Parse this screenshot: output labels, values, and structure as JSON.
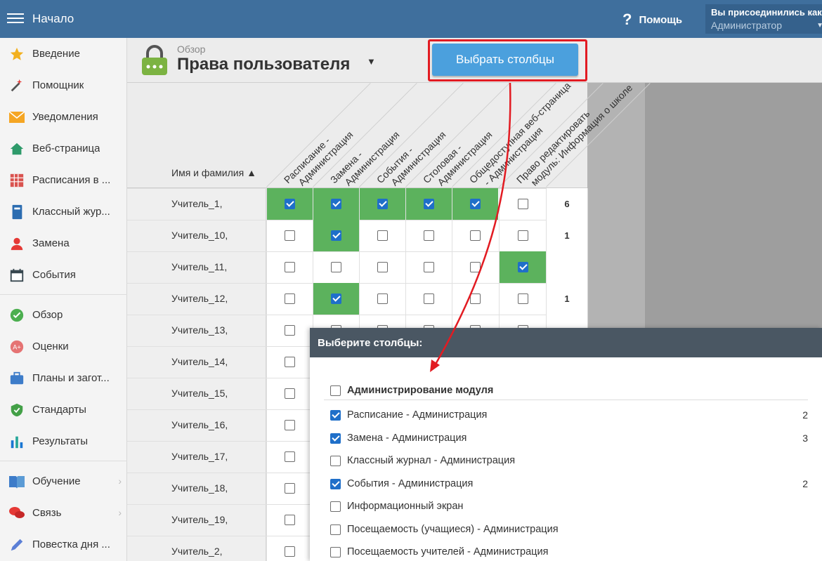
{
  "topbar": {
    "home": "Начало",
    "help": "Помощь",
    "user_line1": "Вы присоединились как",
    "user_line2": "Администратор"
  },
  "sidebar": {
    "items": [
      {
        "label": "Введение",
        "icon": "star-icon"
      },
      {
        "label": "Помощник",
        "icon": "magic-wand-icon"
      },
      {
        "label": "Уведомления",
        "icon": "envelope-icon"
      },
      {
        "label": "Веб-страница",
        "icon": "house-icon"
      },
      {
        "label": "Расписания в ...",
        "icon": "grid-calendar-icon"
      },
      {
        "label": "Классный жур...",
        "icon": "notebook-icon"
      },
      {
        "label": "Замена",
        "icon": "user-icon"
      },
      {
        "label": "События",
        "icon": "calendar-icon"
      },
      {
        "label": "Обзор",
        "icon": "check-circle-icon"
      },
      {
        "label": "Оценки",
        "icon": "grade-icon"
      },
      {
        "label": "Планы и загот...",
        "icon": "briefcase-icon"
      },
      {
        "label": "Стандарты",
        "icon": "shield-icon"
      },
      {
        "label": "Результаты",
        "icon": "bar-chart-icon"
      },
      {
        "label": "Обучение",
        "icon": "book-icon"
      },
      {
        "label": "Связь",
        "icon": "chat-icon"
      },
      {
        "label": "Повестка дня ...",
        "icon": "pen-icon"
      }
    ]
  },
  "header": {
    "overview": "Обзор",
    "title": "Права пользователя",
    "choose_columns": "Выбрать столбцы"
  },
  "table": {
    "name_header": "Имя и фамилия ▲",
    "columns": [
      [
        "Расписание -",
        "Администрация"
      ],
      [
        "Замена -",
        "Администрация"
      ],
      [
        "События -",
        "Администрация"
      ],
      [
        "Столовая -",
        "Администрация"
      ],
      [
        "Общедоступная веб-страница",
        "- Администрация"
      ],
      [
        "Право редактировать",
        "модуль: Информация о школе"
      ]
    ],
    "rows": [
      {
        "name": "Учитель_1,",
        "checks": [
          true,
          true,
          true,
          true,
          true,
          false
        ],
        "count": "6"
      },
      {
        "name": "Учитель_10,",
        "checks": [
          false,
          true,
          false,
          false,
          false,
          false
        ],
        "count": "1"
      },
      {
        "name": "Учитель_11,",
        "checks": [
          false,
          false,
          false,
          false,
          false,
          true
        ],
        "count": ""
      },
      {
        "name": "Учитель_12,",
        "checks": [
          false,
          true,
          false,
          false,
          false,
          false
        ],
        "count": "1"
      },
      {
        "name": "Учитель_13,",
        "checks": [
          false,
          false,
          false,
          false,
          false,
          false
        ],
        "count": ""
      },
      {
        "name": "Учитель_14,",
        "checks": [
          false
        ],
        "count": ""
      },
      {
        "name": "Учитель_15,",
        "checks": [
          false
        ],
        "count": ""
      },
      {
        "name": "Учитель_16,",
        "checks": [
          false
        ],
        "count": ""
      },
      {
        "name": "Учитель_17,",
        "checks": [
          false
        ],
        "count": ""
      },
      {
        "name": "Учитель_18,",
        "checks": [
          false
        ],
        "count": ""
      },
      {
        "name": "Учитель_19,",
        "checks": [
          false
        ],
        "count": ""
      },
      {
        "name": "Учитель_2,",
        "checks": [
          false
        ],
        "count": ""
      }
    ]
  },
  "dialog": {
    "title": "Выберите столбцы:",
    "group": "Администрирование модуля",
    "options": [
      {
        "label": "Расписание - Администрация",
        "checked": true,
        "count": "2"
      },
      {
        "label": "Замена - Администрация",
        "checked": true,
        "count": "3"
      },
      {
        "label": "Классный журнал - Администрация",
        "checked": false,
        "count": ""
      },
      {
        "label": "События - Администрация",
        "checked": true,
        "count": "2"
      },
      {
        "label": "Информационный экран",
        "checked": false,
        "count": ""
      },
      {
        "label": "Посещаемость (учащиеся) - Администрация",
        "checked": false,
        "count": ""
      },
      {
        "label": "Посещаемость учителей - Администрация",
        "checked": false,
        "count": ""
      }
    ]
  },
  "colors": {
    "topbar": "#3f6f9d",
    "checked_cell": "#5cb25d",
    "button": "#4ba0dd",
    "highlight": "#e21b22",
    "dialog_header": "#4a5763"
  }
}
